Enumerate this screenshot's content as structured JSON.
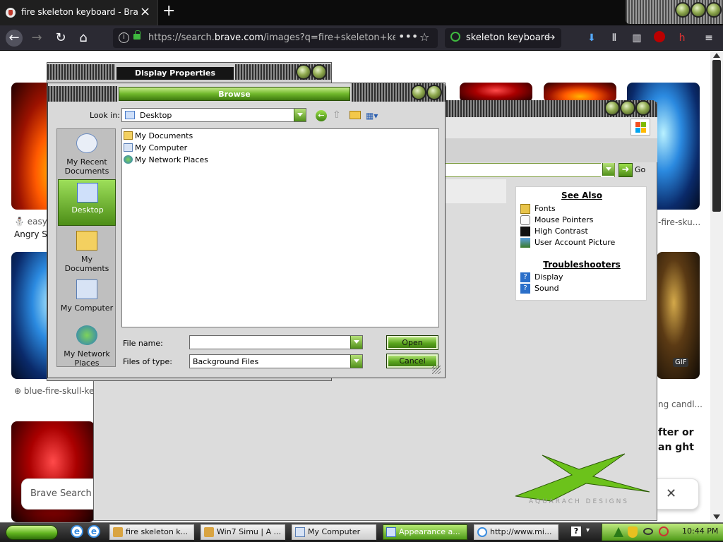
{
  "browser": {
    "tab_title": "fire skeleton keyboard - Brave Search",
    "url_prefix": "https://search.",
    "url_domain": "brave.com",
    "url_rest": "/images?q=fire+skeleton+keyb",
    "search_box": "skeleton keyboard"
  },
  "page": {
    "result1_source": "easy-",
    "result1_title": "Angry Sk",
    "result2_right": "-fire-sku...",
    "result3_source": "blue-fire-skull-key",
    "result4_right": "ng candl...",
    "gif_badge": "GIF",
    "banner_text": "Brave Search u",
    "partial_text": "fter or an ght"
  },
  "appearance": {
    "go_label": "Go",
    "see_also": "See Also",
    "see_also_items": [
      "Fonts",
      "Mouse Pointers",
      "High Contrast",
      "User Account Picture"
    ],
    "troubleshooters": "Troubleshooters",
    "trouble_items": [
      "Display",
      "Sound"
    ],
    "logo_text": "AQUARACH DESIGNS"
  },
  "display_properties": {
    "title": "Display Properties"
  },
  "browse": {
    "title": "Browse",
    "look_in_label": "Look in:",
    "look_in_value": "Desktop",
    "places": [
      "My Recent Documents",
      "Desktop",
      "My Documents",
      "My Computer",
      "My Network Places"
    ],
    "files": [
      "My Documents",
      "My Computer",
      "My Network Places"
    ],
    "file_name_label": "File name:",
    "file_name_value": "",
    "files_of_type_label": "Files of type:",
    "files_of_type_value": "Background Files",
    "open_label": "Open",
    "cancel_label": "Cancel"
  },
  "taskbar": {
    "tasks": [
      "fire skeleton k...",
      "Win7 Simu | A ...",
      "My Computer",
      "Appearance a...",
      "http://www.mi..."
    ],
    "clock": "10:44 PM"
  },
  "colors": {
    "accent_green": "#6fb72a",
    "chrome_dark": "#2b2a33"
  }
}
